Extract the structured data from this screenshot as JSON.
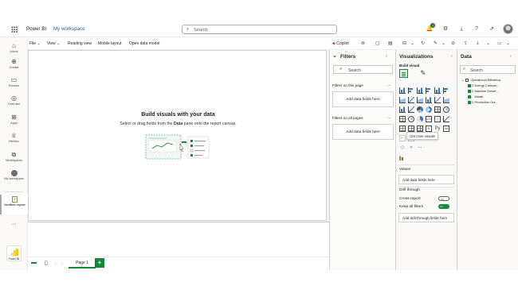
{
  "topbar": {
    "brand": "Power BI",
    "workspace": "My workspace",
    "search_placeholder": "Search",
    "notification_count": "1"
  },
  "rail": {
    "items": [
      {
        "label": "Home",
        "icon": "home-icon"
      },
      {
        "label": "Create",
        "icon": "plus-circle-icon"
      },
      {
        "label": "Browse",
        "icon": "folder-icon"
      },
      {
        "label": "OneLake",
        "icon": "onelake-icon"
      },
      {
        "label": "Apps",
        "icon": "apps-icon"
      },
      {
        "label": "Metrics",
        "icon": "trophy-icon"
      },
      {
        "label": "Workspaces",
        "icon": "workspaces-icon"
      },
      {
        "label": "My workspace",
        "icon": "my-workspace-icon"
      },
      {
        "label": "Untitled report",
        "icon": "report-icon"
      }
    ],
    "more": "···",
    "logo_label": "Power BI"
  },
  "ribbon": {
    "file": "File",
    "view": "View",
    "reading_view": "Reading view",
    "mobile_layout": "Mobile layout",
    "open_data_model": "Open data model",
    "copilot": "Copilot"
  },
  "canvas": {
    "title": "Build visuals with your data",
    "subtitle_pre": "Select or drag fields from the ",
    "subtitle_bold": "Data",
    "subtitle_post": " pane onto the report canvas."
  },
  "bottom": {
    "page_tab": "Page 1",
    "add": "+"
  },
  "filters": {
    "title": "Filters",
    "search": "Search",
    "on_page": "Filters on this page",
    "on_all": "Filters on all pages",
    "add_fields": "Add data fields here",
    "dots": "..."
  },
  "viz": {
    "title": "Visualizations",
    "build_visual": "Build visual",
    "tooltip": "Get more visuals",
    "values": "Values",
    "values_box": "Add data fields here",
    "drill_through": "Drill through",
    "cross_report": "Cross-report",
    "cross_report_state": "Off",
    "keep_filters": "Keep all filters",
    "keep_filters_state": "On",
    "drill_box": "Add drill-through fields here",
    "more_dots": "..."
  },
  "data_pane": {
    "title": "Data",
    "search": "Search",
    "table": "Operational Efficiency",
    "fields": [
      {
        "name": "Energy Consum...",
        "sigma": true,
        "checked": true
      },
      {
        "name": "Machine Downt...",
        "sigma": true,
        "checked": true
      },
      {
        "name": "Month",
        "sigma": false,
        "checked": true
      },
      {
        "name": "Production Out...",
        "sigma": true,
        "checked": true
      }
    ]
  },
  "colors": {
    "accent_green": "#118a38",
    "link_blue": "#1f5fa8",
    "brand_yellow": "#f2c811"
  }
}
